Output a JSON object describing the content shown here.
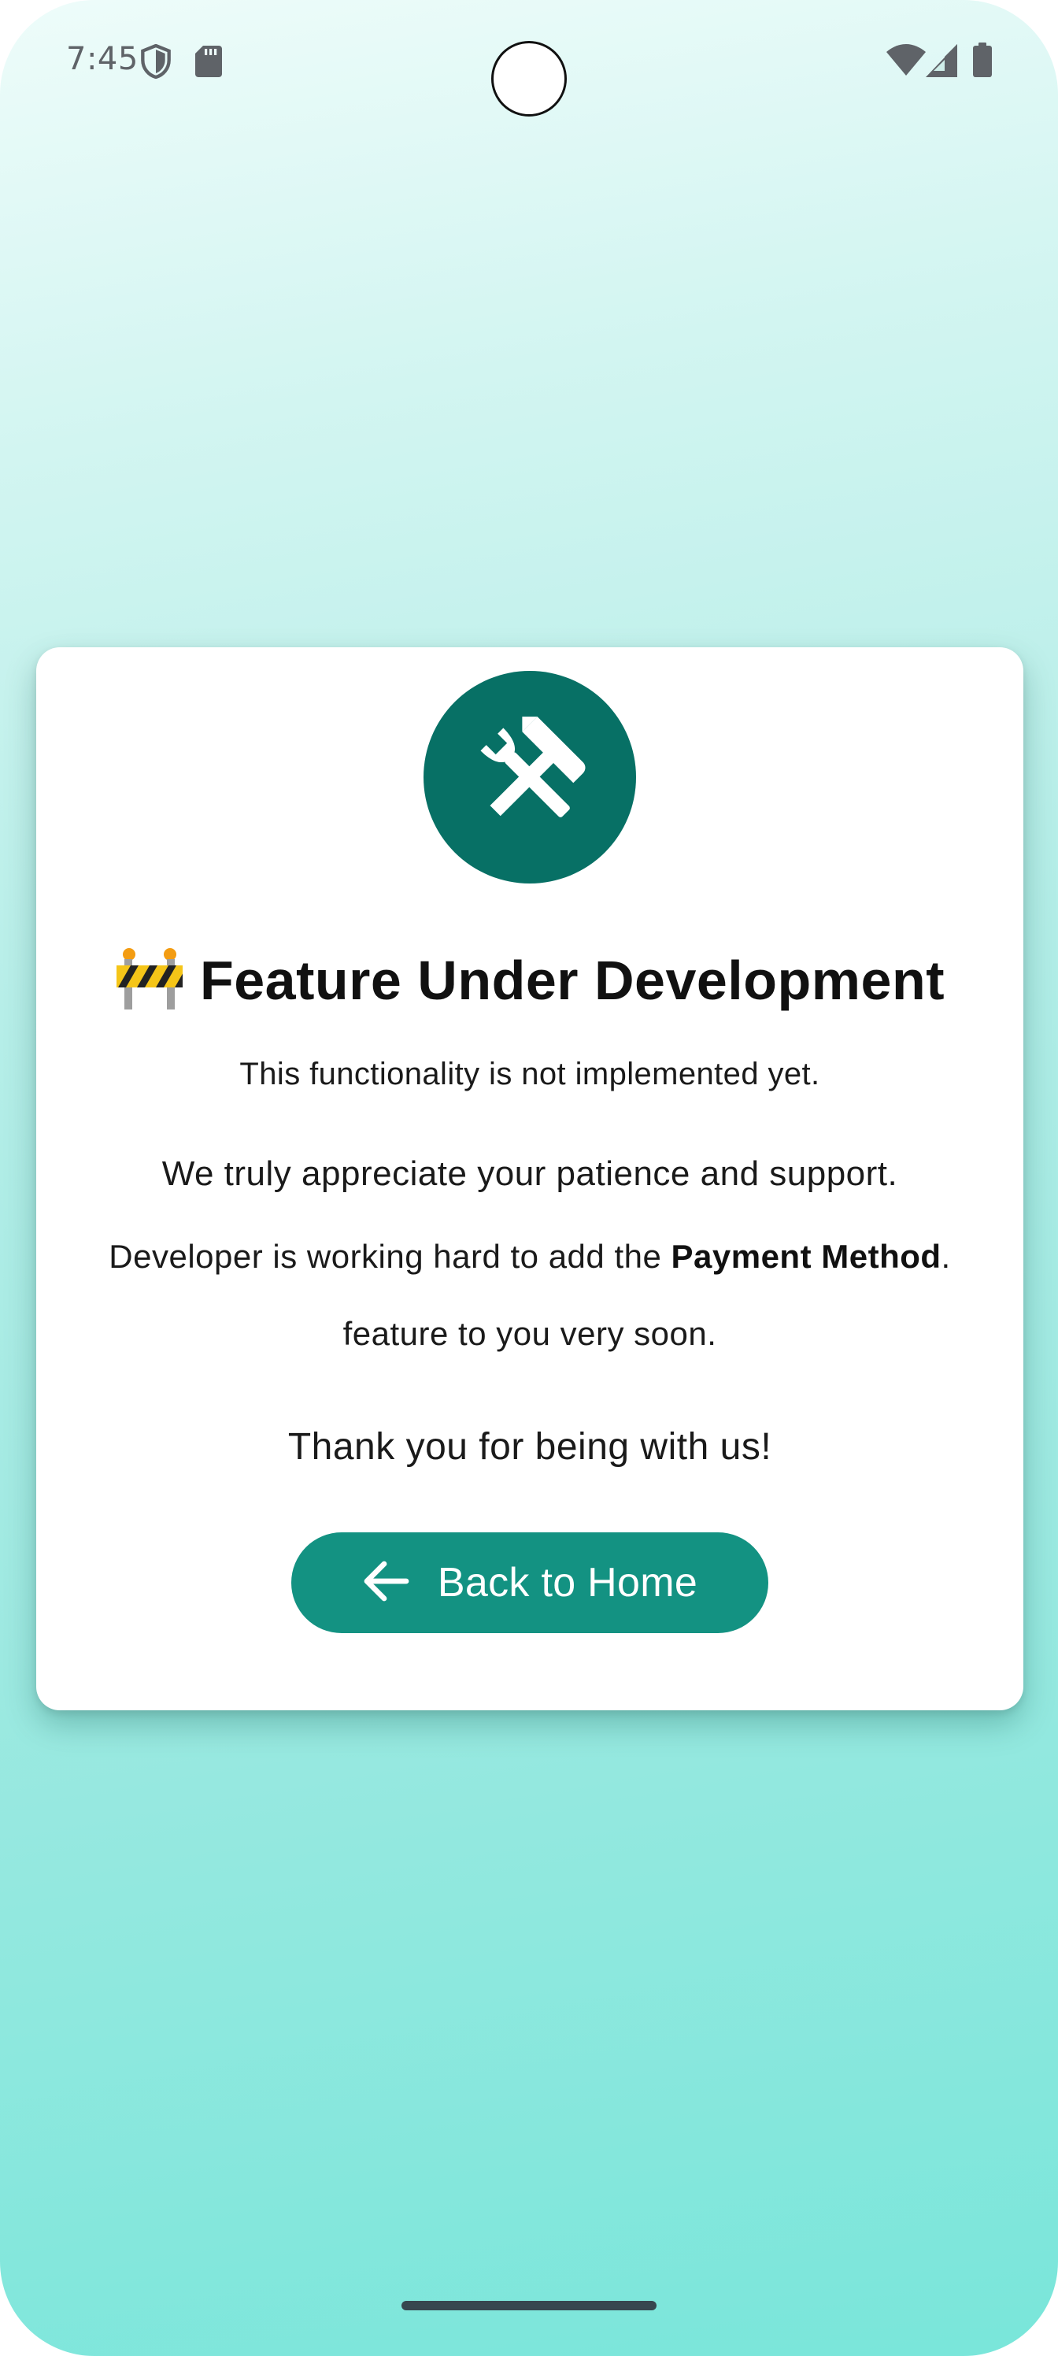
{
  "status_bar": {
    "time": "7:45",
    "icons": [
      "shield-icon",
      "sd-card-icon",
      "wifi-icon",
      "signal-icon",
      "battery-icon"
    ]
  },
  "card": {
    "icon": "tools-icon",
    "title_emoji_icon": "construction-barrier-icon",
    "title": "Feature Under Development",
    "subtitle": "This functionality is not implemented yet.",
    "appreciation": "We truly appreciate your patience and support.",
    "developer_prefix": "Developer is working hard to add the ",
    "feature_name": "Payment Method",
    "developer_suffix": ".",
    "feature_line": "feature to you very soon.",
    "thanks": "Thank you for being with us!",
    "back_button_label": "Back to Home",
    "back_button_icon": "arrow-left-icon"
  },
  "colors": {
    "accent_dark": "#077065",
    "accent_button": "#139282",
    "background_top": "#eefcfa",
    "background_bottom": "#79e6da"
  }
}
